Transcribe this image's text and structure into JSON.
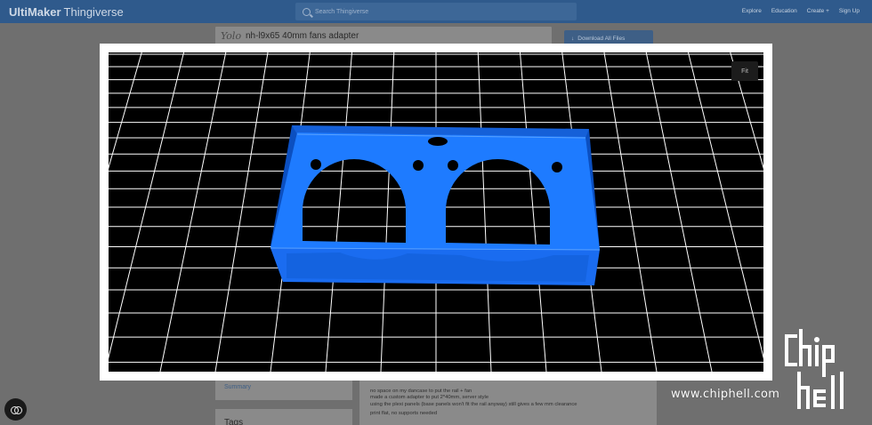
{
  "header": {
    "brand_bold": "UltiMaker",
    "brand_light": "Thingiverse",
    "search_placeholder": "Search Thingiverse",
    "nav": [
      "Explore",
      "Education",
      "Create +",
      "Sign Up"
    ]
  },
  "thing": {
    "author_logo": "Yolo",
    "title": "nh-l9x65 40mm fans adapter",
    "download_label": "Download All Files"
  },
  "sidebar": {
    "summary_link": "Summary",
    "tags_heading": "Tags"
  },
  "description": {
    "lines": [
      "no space on my dancase to put the rail + fan",
      "made a custom adapter to put 2*40mm, server style",
      "using the plexi panels (base panels won't fit the rail anyway) still gives a few mm clearance",
      "print flat, no supports needed"
    ]
  },
  "viewer": {
    "fit_label": "Fit",
    "background": "#000000",
    "grid_color": "#ffffff",
    "model_color": "#1e7bff"
  },
  "watermark": {
    "url": "www.chiphell.com",
    "logo_text": "chip hell"
  },
  "icons": {
    "search": "search-icon",
    "download": "download-icon",
    "float_button": "glasses-icon"
  }
}
